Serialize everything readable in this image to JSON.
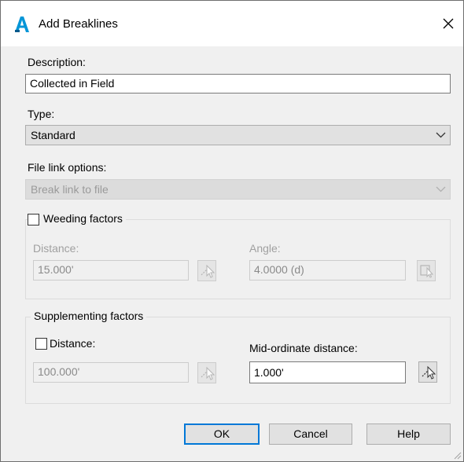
{
  "window": {
    "title": "Add Breaklines"
  },
  "description": {
    "label": "Description:",
    "value": "Collected in Field"
  },
  "type": {
    "label": "Type:",
    "selected": "Standard"
  },
  "file_link": {
    "label": "File link options:",
    "selected": "Break link to file"
  },
  "weeding": {
    "label": "Weeding factors",
    "checked": false,
    "distance_label": "Distance:",
    "distance_value": "15.000'",
    "angle_label": "Angle:",
    "angle_value": "4.0000 (d)"
  },
  "supplementing": {
    "label": "Supplementing factors",
    "distance_label": "Distance:",
    "distance_checked": false,
    "distance_value": "100.000'",
    "mid_label": "Mid-ordinate distance:",
    "mid_value": "1.000'"
  },
  "buttons": {
    "ok": "OK",
    "cancel": "Cancel",
    "help": "Help"
  },
  "colors": {
    "accent": "#0078d7",
    "app_icon": "#0696d7"
  }
}
